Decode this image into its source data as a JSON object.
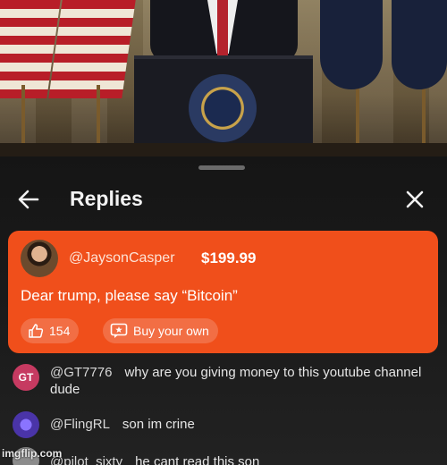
{
  "header": {
    "title": "Replies"
  },
  "super_chat": {
    "username": "@JaysonCasper",
    "amount": "$199.99",
    "message": "Dear trump, please say “Bitcoin”",
    "likes": "154",
    "buy_label": "Buy your own",
    "color": "#f04f1b"
  },
  "comments": [
    {
      "avatar_text": "GT",
      "avatar_color": "#c63a61",
      "username": "@GT7776",
      "text": "why are you giving money to this youtube channel dude"
    },
    {
      "avatar_text": "",
      "avatar_color": "#5a46b8",
      "username": "@FlingRL",
      "text": "son im crine"
    },
    {
      "avatar_text": "",
      "avatar_color": "#8c8c8c",
      "username": "@pilot_sixty",
      "text": "he cant read this son"
    }
  ],
  "watermark": "imgflip.com"
}
